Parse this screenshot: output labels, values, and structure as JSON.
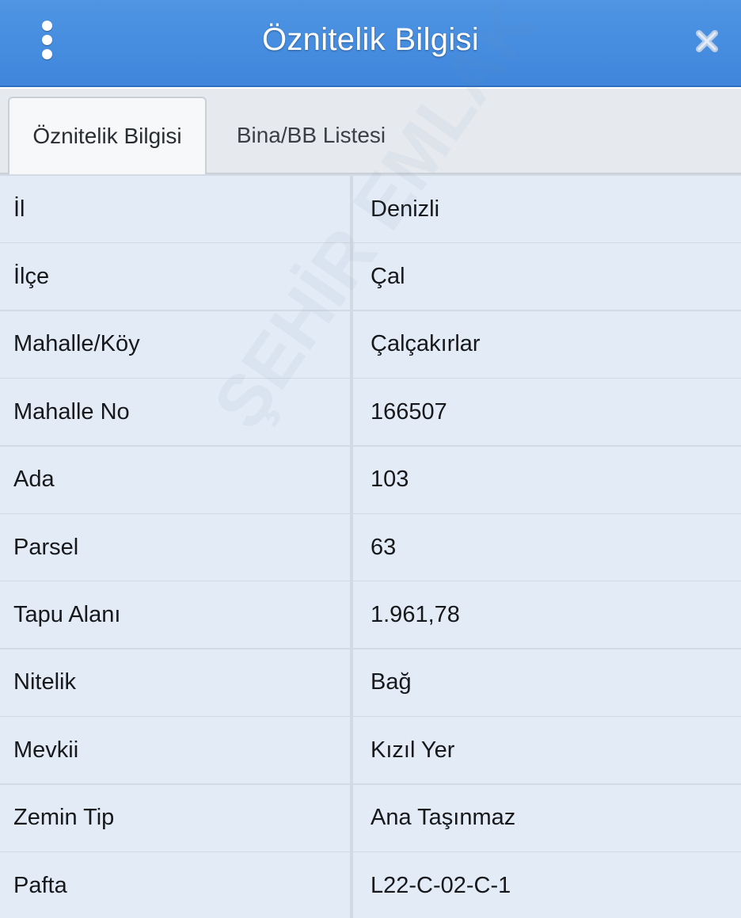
{
  "header": {
    "title": "Öznitelik Bilgisi",
    "menu_icon": "vertical-dots-icon",
    "close_icon": "close-icon"
  },
  "tabs": [
    {
      "label": "Öznitelik Bilgisi",
      "active": true
    },
    {
      "label": "Bina/BB Listesi",
      "active": false
    }
  ],
  "rows": [
    {
      "key": "İl",
      "value": "Denizli"
    },
    {
      "key": "İlçe",
      "value": "Çal"
    },
    {
      "key": "Mahalle/Köy",
      "value": "Çalçakırlar"
    },
    {
      "key": "Mahalle No",
      "value": "166507"
    },
    {
      "key": "Ada",
      "value": "103"
    },
    {
      "key": "Parsel",
      "value": "63"
    },
    {
      "key": "Tapu Alanı",
      "value": "1.961,78"
    },
    {
      "key": "Nitelik",
      "value": "Bağ"
    },
    {
      "key": "Mevkii",
      "value": "Kızıl Yer"
    },
    {
      "key": "Zemin Tip",
      "value": "Ana Taşınmaz"
    },
    {
      "key": "Pafta",
      "value": "L22-C-02-C-1"
    }
  ],
  "colors": {
    "header_bg": "#4289de",
    "tabbar_bg": "#e6eaef",
    "row_bg": "#e2ebf6",
    "divider": "#d2dae3"
  }
}
